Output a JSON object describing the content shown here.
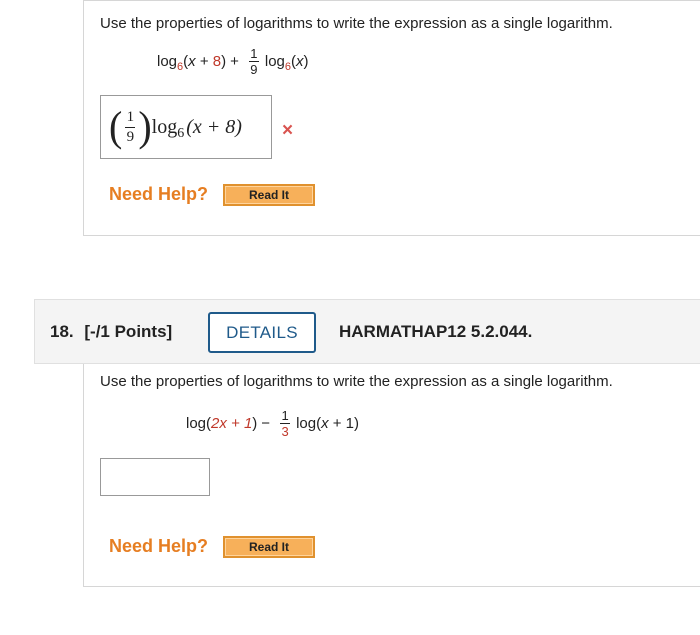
{
  "q17": {
    "prompt": "Use the properties of logarithms to write the expression as a single logarithm.",
    "expr": {
      "log1": "log",
      "base1": "6",
      "arg1_open": "(",
      "arg1_x": "x",
      "arg1_plus": " + ",
      "arg1_const": "8",
      "arg1_close": ")",
      "plus": "+",
      "frac_num": "1",
      "frac_den": "9",
      "log2": "log",
      "base2": "6",
      "arg2_open": "(",
      "arg2_x": "x",
      "arg2_close": ")"
    },
    "answer": {
      "frac_num": "1",
      "frac_den": "9",
      "log": "log",
      "base": "6",
      "arg": "(x + 8)"
    },
    "status_icon": "×",
    "need_help": "Need Help?",
    "read_it": "Read It"
  },
  "q18": {
    "number": "18.",
    "points": "[-/1 Points]",
    "details": "DETAILS",
    "reference": "HARMATHAP12 5.2.044.",
    "prompt": "Use the properties of logarithms to write the expression as a single logarithm.",
    "expr": {
      "log1": "log(",
      "arg1": "2x + 1",
      "close1": ")",
      "minus": "−",
      "frac_num": "1",
      "frac_den": "3",
      "log2": "log(",
      "arg2_x": "x",
      "arg2_rest": " + 1)"
    },
    "answer_value": "",
    "need_help": "Need Help?",
    "read_it": "Read It"
  },
  "colors": {
    "accent_blue": "#1f5a8a",
    "help_orange": "#e67e22",
    "error_red": "#d9534f",
    "button_orange": "#f7b05a"
  }
}
